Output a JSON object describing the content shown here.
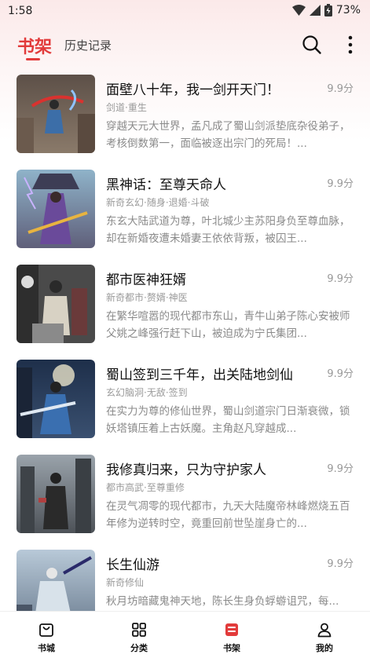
{
  "status_bar": {
    "time": "1:58",
    "battery": "73%"
  },
  "header": {
    "active_tab": "书架",
    "inactive_tab": "历史记录"
  },
  "books": [
    {
      "title": "面壁八十年，我一剑开天门！",
      "score": "9.9分",
      "tags": "剑道·重生",
      "desc": "穿越天元大世界，孟凡成了蜀山剑派垫底杂役弟子，考核倒数第一，面临被逐出宗门的死局！..."
    },
    {
      "title": "黑神话：至尊天命人",
      "score": "9.9分",
      "tags": "新奇玄幻·随身·退婚·斗破",
      "desc": "东玄大陆武道为尊，叶北城少主苏阳身负至尊血脉，却在新婚夜遭未婚妻王依依背叛，被囚王..."
    },
    {
      "title": "都市医神狂婿",
      "score": "9.9分",
      "tags": "新奇都市·赘婿·神医",
      "desc": "在繁华喧嚣的现代都市东山，青牛山弟子陈心安被师父姚之峰强行赶下山，被迫成为宁氏集团..."
    },
    {
      "title": "蜀山签到三千年，出关陆地剑仙",
      "score": "9.9分",
      "tags": "玄幻脑洞·无敌·签到",
      "desc": "在实力为尊的修仙世界，蜀山剑道宗门日渐衰微，锁妖塔镇压着上古妖魔。主角赵凡穿越成..."
    },
    {
      "title": "我修真归来，只为守护家人",
      "score": "9.9分",
      "tags": "都市高武·至尊重修",
      "desc": "在灵气凋零的现代都市，九天大陆魔帝林峰燃烧五百年修为逆转时空，竟重回前世坠崖身亡的..."
    },
    {
      "title": "长生仙游",
      "score": "9.9分",
      "tags": "新奇修仙",
      "desc": "秋月坊暗藏鬼神天地，陈长生身负蜉蝣诅咒，每..."
    }
  ],
  "bottom_nav": [
    {
      "label": "书城",
      "icon": "bookstore-icon"
    },
    {
      "label": "分类",
      "icon": "category-grid-icon"
    },
    {
      "label": "书架",
      "icon": "bookshelf-icon"
    },
    {
      "label": "我的",
      "icon": "profile-icon"
    }
  ],
  "colors": {
    "accent": "#e23b3b",
    "text": "#111111",
    "muted": "#8a8a8a"
  }
}
